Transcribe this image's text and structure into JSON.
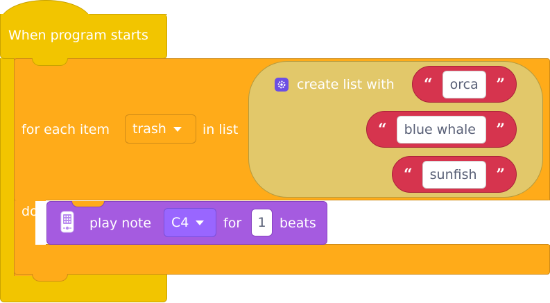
{
  "event_block": {
    "label": "When program starts",
    "color": "#F2C500"
  },
  "loop_block": {
    "prefix": "for each item",
    "variable": "trash",
    "infix": "in list",
    "do_label": "do",
    "color": "#FFAB19"
  },
  "list_block": {
    "label": "create list with",
    "icon": "gear-icon",
    "color": "#E2C86A",
    "items": [
      {
        "value": "orca"
      },
      {
        "value": "blue whale"
      },
      {
        "value": "sunfish"
      }
    ],
    "open_quote": "“",
    "close_quote": "”",
    "item_color": "#D6344E"
  },
  "play_block": {
    "icon": "hub-display-icon",
    "label": "play note",
    "note": "C4",
    "for_label": "for",
    "beats_value": "1",
    "beats_label": "beats",
    "color": "#A55BE0"
  }
}
